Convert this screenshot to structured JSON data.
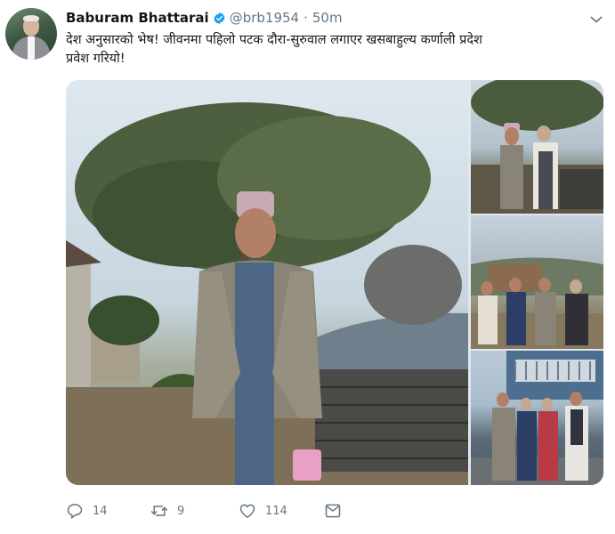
{
  "tweet": {
    "author_name": "Baburam Bhattarai",
    "author_handle": "@brb1954",
    "separator": "·",
    "time": "50m",
    "text_line1": "देश अनुसारको भेष! जीवनमा पहिलो पटक दौरा-सुरुवाल लगाएर खसबाहुल्य कर्णाली प्रदेश",
    "text_line2": "प्रवेश गरियो!"
  },
  "actions": {
    "reply_count": "14",
    "retweet_count": "9",
    "like_count": "114"
  },
  "icons": {
    "verified": "verified-badge-icon",
    "caret": "chevron-down-icon",
    "reply": "reply-icon",
    "retweet": "retweet-icon",
    "like": "heart-icon",
    "dm": "envelope-icon"
  },
  "colors": {
    "accent": "#1da1f2",
    "text_primary": "#14171a",
    "text_secondary": "#657786"
  }
}
